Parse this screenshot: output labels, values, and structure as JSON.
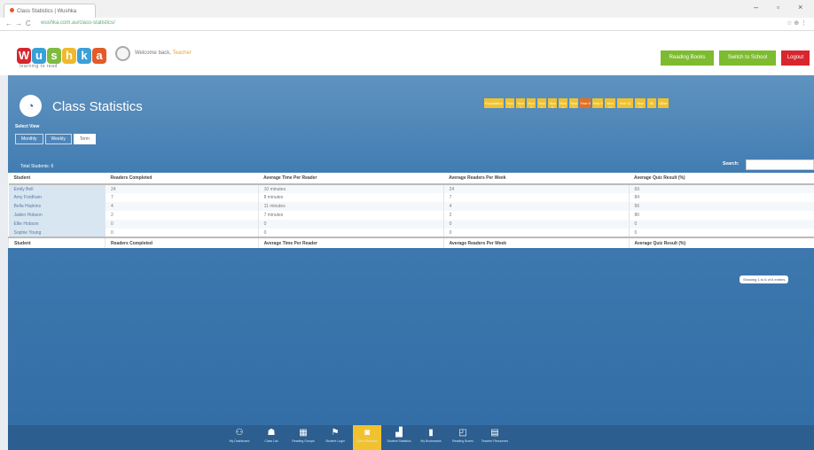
{
  "browser": {
    "tab_title": "Class Statistics | Wushka",
    "url": "wushka.com.au/class-statistics/",
    "win_minimize": "–",
    "win_maximize": "▫",
    "win_close": "×",
    "back_glyph": "←",
    "forward_glyph": "→",
    "reload_glyph": "C",
    "extensions": "☆ ⊕ ⋮"
  },
  "header": {
    "logo_letters": [
      "W",
      "u",
      "s",
      "h",
      "k",
      "a"
    ],
    "logo_colors": [
      "#d7262d",
      "#3aa0d8",
      "#7ebc3f",
      "#f1b82d",
      "#3aa0d8",
      "#e35b2b"
    ],
    "tagline": "learning to read",
    "welcome_text": "Welcome back,",
    "user_name": "Teacher",
    "buttons": [
      {
        "label": "Reading Books",
        "color": "#7dbb2f"
      },
      {
        "label": "Switch to School",
        "color": "#7dbb2f"
      },
      {
        "label": "Logout",
        "color": "#d7262d"
      }
    ]
  },
  "page": {
    "title": "Class Statistics",
    "title_icon": "◔",
    "year_tabs": [
      "Foundation",
      "Year 1",
      "Year 2",
      "Year 3",
      "Year 4",
      "Year 5",
      "Year 6",
      "Year 7",
      "Year 8",
      "Year 9",
      "Year 10",
      "Year 11",
      "Year 12",
      "All",
      "Other"
    ],
    "active_year_tab": 8,
    "select_view_label": "Select View",
    "views": [
      "Monthly",
      "Weekly",
      "Term"
    ],
    "active_view": 2,
    "total_students_label": "Total Students: 6",
    "search_label": "Search:",
    "search_value": ""
  },
  "table": {
    "columns": [
      "Student",
      "Readers Completed",
      "Average Time Per Reader",
      "Average Readers Per Week",
      "Average Quiz Result (%)"
    ],
    "rows": [
      [
        "Emily Bell",
        "24",
        "10 minutes",
        "24",
        "69"
      ],
      [
        "Amy Fordham",
        "7",
        "8 minutes",
        "7",
        "84"
      ],
      [
        "Bella Hopkins",
        "4",
        "11 minutes",
        "4",
        "56"
      ],
      [
        "Jaden Hobson",
        "2",
        "7 minutes",
        "2",
        "80"
      ],
      [
        "Ellie Hobson",
        "0",
        "0",
        "0",
        "0"
      ],
      [
        "Sophie Young",
        "0",
        "0",
        "0",
        "0"
      ]
    ]
  },
  "showing_text": "Showing 1 to 6 of 6 entries",
  "bottom_nav": [
    {
      "label": "My Dashboard",
      "icon": "⚇"
    },
    {
      "label": "Class List",
      "icon": "☗"
    },
    {
      "label": "Reading Groups",
      "icon": "▦"
    },
    {
      "label": "Student Login",
      "icon": "⚑"
    },
    {
      "label": "Class Statistics",
      "icon": "◙"
    },
    {
      "label": "Student Statistics",
      "icon": "▟"
    },
    {
      "label": "My Bookmarks",
      "icon": "▮"
    },
    {
      "label": "Reading Boxes",
      "icon": "◰"
    },
    {
      "label": "Teacher Resources",
      "icon": "▤"
    }
  ],
  "active_bottom_nav": 4
}
